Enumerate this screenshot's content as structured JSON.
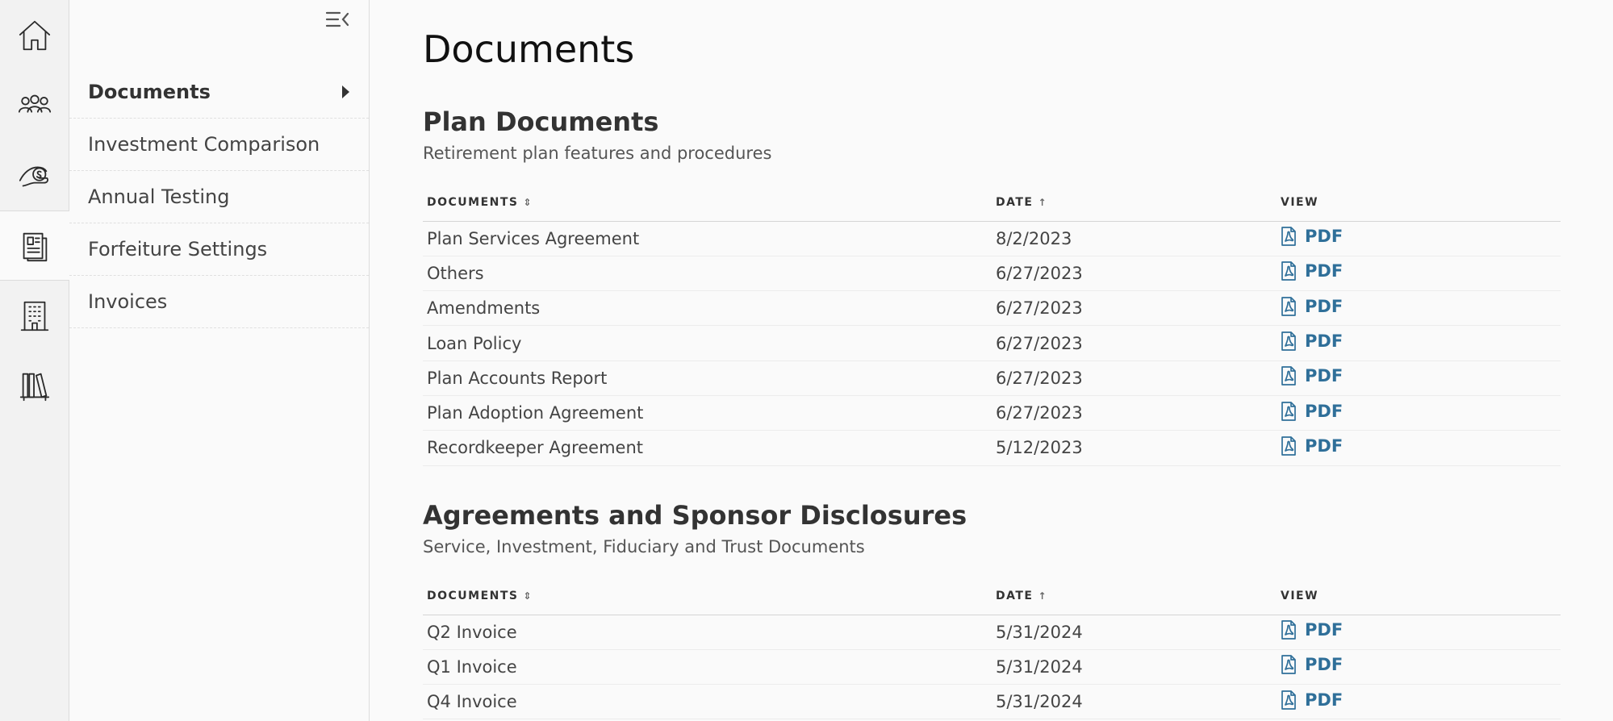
{
  "rail": {
    "items": [
      {
        "name": "home-icon"
      },
      {
        "name": "people-icon"
      },
      {
        "name": "hand-money-icon"
      },
      {
        "name": "documents-icon",
        "active": true
      },
      {
        "name": "building-icon"
      },
      {
        "name": "library-icon"
      }
    ]
  },
  "subnav": {
    "items": [
      {
        "label": "Documents"
      },
      {
        "label": "Investment Comparison"
      },
      {
        "label": "Annual Testing"
      },
      {
        "label": "Forfeiture Settings"
      },
      {
        "label": "Invoices"
      }
    ]
  },
  "page": {
    "title": "Documents"
  },
  "sections": [
    {
      "title": "Plan Documents",
      "subtitle": "Retirement plan features and procedures",
      "headers": {
        "documents": "DOCUMENTS",
        "date": "DATE",
        "view": "VIEW"
      },
      "rows": [
        {
          "name": "Plan Services Agreement",
          "date": "8/2/2023",
          "view": "PDF"
        },
        {
          "name": "Others",
          "date": "6/27/2023",
          "view": "PDF"
        },
        {
          "name": "Amendments",
          "date": "6/27/2023",
          "view": "PDF"
        },
        {
          "name": "Loan Policy",
          "date": "6/27/2023",
          "view": "PDF"
        },
        {
          "name": "Plan Accounts Report",
          "date": "6/27/2023",
          "view": "PDF"
        },
        {
          "name": "Plan Adoption Agreement",
          "date": "6/27/2023",
          "view": "PDF"
        },
        {
          "name": "Recordkeeper Agreement",
          "date": "5/12/2023",
          "view": "PDF"
        }
      ]
    },
    {
      "title": "Agreements and Sponsor Disclosures",
      "subtitle": "Service, Investment, Fiduciary and Trust Documents",
      "headers": {
        "documents": "DOCUMENTS",
        "date": "DATE",
        "view": "VIEW"
      },
      "rows": [
        {
          "name": "Q2 Invoice",
          "date": "5/31/2024",
          "view": "PDF"
        },
        {
          "name": "Q1 Invoice",
          "date": "5/31/2024",
          "view": "PDF"
        },
        {
          "name": "Q4 Invoice",
          "date": "5/31/2024",
          "view": "PDF"
        }
      ]
    }
  ],
  "colors": {
    "link": "#2f6f99",
    "rail_bg": "#f2f2f2",
    "page_bg": "#fafafa"
  }
}
